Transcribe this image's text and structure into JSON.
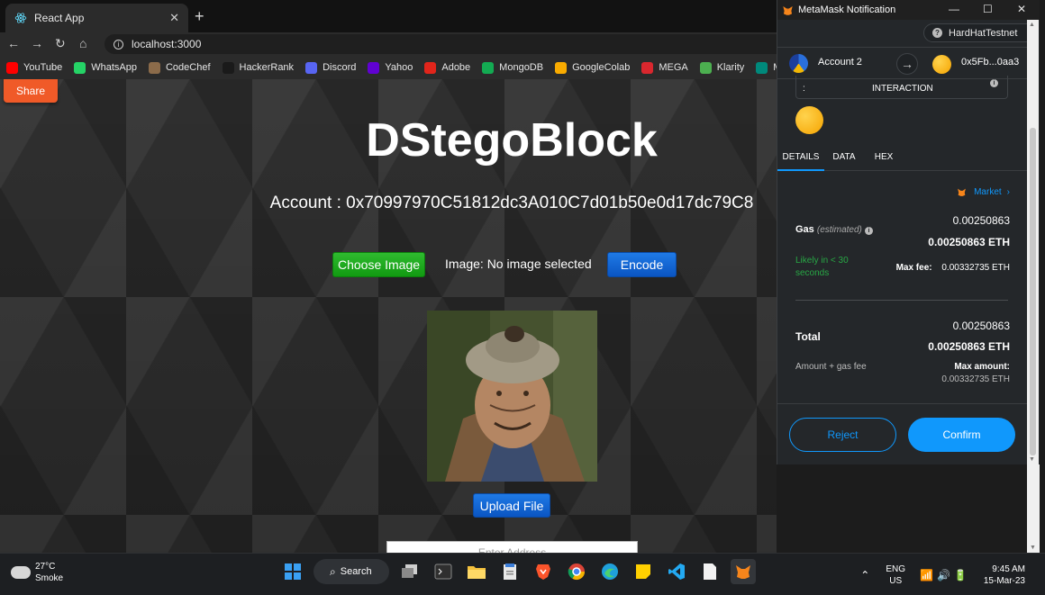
{
  "browser": {
    "tab_title": "React App",
    "url": "localhost:3000",
    "bookmarks": [
      {
        "label": "YouTube",
        "icon": "youtube-icon",
        "color": "#ff0000"
      },
      {
        "label": "WhatsApp",
        "icon": "whatsapp-icon",
        "color": "#25d366"
      },
      {
        "label": "CodeChef",
        "icon": "codechef-icon",
        "color": "#8b6b4a"
      },
      {
        "label": "HackerRank",
        "icon": "hackerrank-icon",
        "color": "#1a1a1a"
      },
      {
        "label": "Discord",
        "icon": "discord-icon",
        "color": "#5865f2"
      },
      {
        "label": "Yahoo",
        "icon": "yahoo-icon",
        "color": "#6001d2"
      },
      {
        "label": "Adobe",
        "icon": "adobe-icon",
        "color": "#e1251b"
      },
      {
        "label": "MongoDB",
        "icon": "mongodb-icon",
        "color": "#13aa52"
      },
      {
        "label": "GoogleColab",
        "icon": "colab-icon",
        "color": "#f9ab00"
      },
      {
        "label": "MEGA",
        "icon": "mega-icon",
        "color": "#d9272e"
      },
      {
        "label": "Klarity",
        "icon": "klarity-icon",
        "color": "#4caf50"
      },
      {
        "label": "Mee",
        "icon": "meet-icon",
        "color": "#00897b"
      }
    ]
  },
  "app": {
    "share_label": "Share",
    "title": "DStegoBlock",
    "account_line": "Account : 0x70997970C51812dc3A010C7d01b50e0d17dc79C8",
    "choose_image_label": "Choose Image",
    "image_status": "Image: No image selected",
    "encode_label": "Encode",
    "upload_label": "Upload File",
    "address_placeholder": "Enter Address"
  },
  "metamask": {
    "window_title": "MetaMask Notification",
    "network": "HardHatTestnet",
    "from_account": "Account 2",
    "to_account": "0x5Fb...0aa3",
    "interaction_colon": ":",
    "interaction_text": "INTERACTION",
    "tabs": [
      "DETAILS",
      "DATA",
      "HEX"
    ],
    "market_label": "Market",
    "gas_label": "Gas",
    "gas_estimated": "(estimated)",
    "gas_value": "0.00250863",
    "gas_value_eth": "0.00250863 ETH",
    "likely_text": "Likely in < 30 seconds",
    "max_fee_label": "Max fee:",
    "max_fee_value": "0.00332735 ETH",
    "total_label": "Total",
    "total_value": "0.00250863",
    "total_value_eth": "0.00250863 ETH",
    "amount_gas_label": "Amount + gas fee",
    "max_amount_label": "Max amount:",
    "max_amount_value": "0.00332735 ETH",
    "reject_label": "Reject",
    "confirm_label": "Confirm",
    "accent_color": "#1098fc"
  },
  "taskbar": {
    "temperature": "27°C",
    "weather": "Smoke",
    "search_label": "Search",
    "lang_1": "ENG",
    "lang_2": "US",
    "time": "9:45 AM",
    "date": "15-Mar-23"
  }
}
